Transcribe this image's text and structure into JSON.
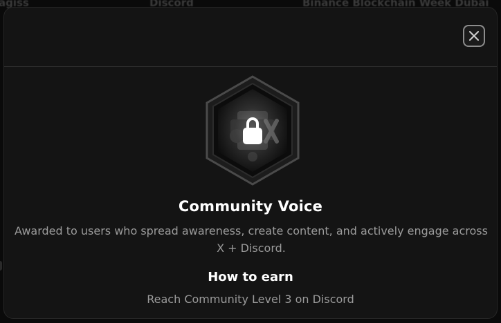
{
  "background": {
    "left_text": "agiss",
    "middle_text": "Discord",
    "right_text": "Binance Blockchain Week Dubai"
  },
  "modal": {
    "close_icon": "close-icon",
    "badge": {
      "icon": "lock-icon",
      "state": "locked",
      "title": "Community Voice",
      "description": "Awarded to users who spread awareness, create content, and actively engage across X + Discord."
    },
    "how_to_earn": {
      "heading": "How to earn",
      "requirement": "Reach Community Level 3 on Discord"
    }
  },
  "colors": {
    "modal_background": "#141414",
    "title_text": "#ffffff",
    "secondary_text": "#9b9b9b"
  }
}
